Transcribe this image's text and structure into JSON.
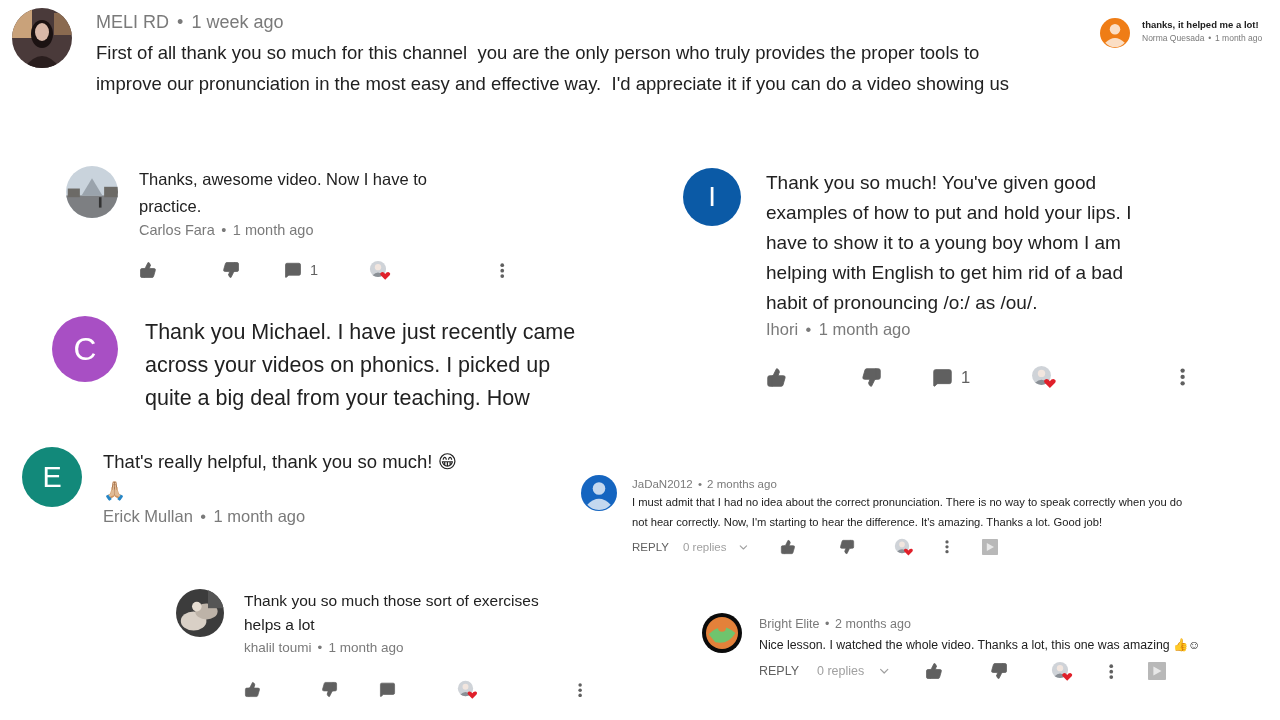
{
  "comments": [
    {
      "kind": "top_meta",
      "author": "MELI RD",
      "dot": "•",
      "time": "1 week ago",
      "text": "First of all thank you so much for this channel  you are the only person who truly provides the proper tools to\nimprove our pronunciation in the most easy and effective way.  I'd appreciate it if you can do a video showing us"
    },
    {
      "kind": "notification",
      "avatar": {
        "kind": "default",
        "color": "#ef7d16"
      },
      "text": "thanks, it helped me a lot!",
      "author": "Norma Quesada",
      "dot": "•",
      "time": "1 month ago"
    },
    {
      "kind": "bottom_meta",
      "text": "Thanks, awesome video. Now I have to\npractice.",
      "author": "Carlos Fara",
      "dot": "•",
      "time": "1 month ago",
      "actions": {
        "kind": "mobile",
        "comments": "1"
      }
    },
    {
      "kind": "bottom_meta",
      "avatar": {
        "kind": "letter",
        "letter": "I",
        "color": "#0b5aa6"
      },
      "text": "Thank you so much! You've given good\nexamples of how to put and hold your lips. I\nhave to show it to a young boy whom I am\nhelping with English to get him rid of a bad\nhabit of pronouncing /o:/ as /ou/.",
      "author": "Ihori",
      "dot": "•",
      "time": "1 month ago",
      "actions": {
        "kind": "mobile",
        "comments": "1"
      }
    },
    {
      "kind": "text_only",
      "avatar": {
        "kind": "letter",
        "letter": "C",
        "color": "#a84fc4"
      },
      "text": "Thank you Michael. I have just recently came\nacross your videos on phonics. I picked up\nquite a big deal from your teaching. How"
    },
    {
      "kind": "bottom_meta",
      "avatar": {
        "kind": "letter",
        "letter": "E",
        "color": "#12897a"
      },
      "text": "That's really helpful, thank you so much! 😁\n🙏🏼",
      "author": "Erick Mullan",
      "dot": "•",
      "time": "1 month ago"
    },
    {
      "kind": "top_meta",
      "avatar": {
        "kind": "default",
        "color": "#1565c0"
      },
      "author": "JaDaN2012",
      "dot": "•",
      "time": "2 months ago",
      "text": "I must admit that I had no idea about the correct pronunciation. There is no way to speak correctly when you do\nnot hear correctly. Now, I'm starting to hear the difference. It's amazing. Thanks a lot. Good job!",
      "actions": {
        "kind": "desktop",
        "reply": "REPLY",
        "replies": "0 replies"
      }
    },
    {
      "kind": "bottom_meta",
      "text": "Thank you so much those sort of exercises\nhelps a lot",
      "author": "khalil toumi",
      "dot": "•",
      "time": "1 month ago",
      "actions": {
        "kind": "mobile"
      }
    },
    {
      "kind": "top_meta",
      "author": "Bright Elite",
      "dot": "•",
      "time": "2 months ago",
      "text": "Nice lesson. I watched the whole video. Thanks a lot, this one was amazing 👍☺",
      "actions": {
        "kind": "desktop",
        "reply": "REPLY",
        "replies": "0 replies"
      }
    }
  ]
}
